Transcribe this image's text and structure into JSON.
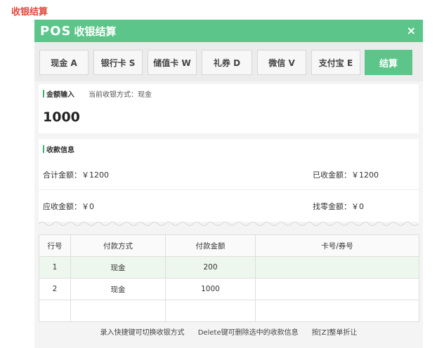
{
  "page_label": "收银结算",
  "window": {
    "logo": "POS",
    "title": "收银结算",
    "close": "×"
  },
  "toolbar": {
    "buttons": [
      {
        "label": "现金 A"
      },
      {
        "label": "银行卡 S"
      },
      {
        "label": "储值卡 W"
      },
      {
        "label": "礼券 D"
      },
      {
        "label": "微信 V"
      },
      {
        "label": "支付宝 E"
      }
    ],
    "settle_label": "结算"
  },
  "amount_input": {
    "title": "金额输入",
    "mode_text": "当前收银方式：现金",
    "value": "1000"
  },
  "collection": {
    "title": "收款信息",
    "total": "合计金额：￥1200",
    "received": "已收金额：￥1200",
    "due": "应收金额：￥0",
    "change": "找零金额：￥0"
  },
  "table": {
    "headers": [
      "行号",
      "付款方式",
      "付款金额",
      "卡号/券号"
    ],
    "rows": [
      {
        "no": "1",
        "method": "现金",
        "amount": "200",
        "card": ""
      },
      {
        "no": "2",
        "method": "现金",
        "amount": "1000",
        "card": ""
      }
    ]
  },
  "footer": {
    "hint1": "录入快捷键可切换收银方式",
    "hint2": "Delete键可删除选中的收款信息",
    "hint3": "按[Z]整单折让"
  },
  "colors": {
    "accent": "#5cc68a",
    "page_label": "#e8463c"
  }
}
